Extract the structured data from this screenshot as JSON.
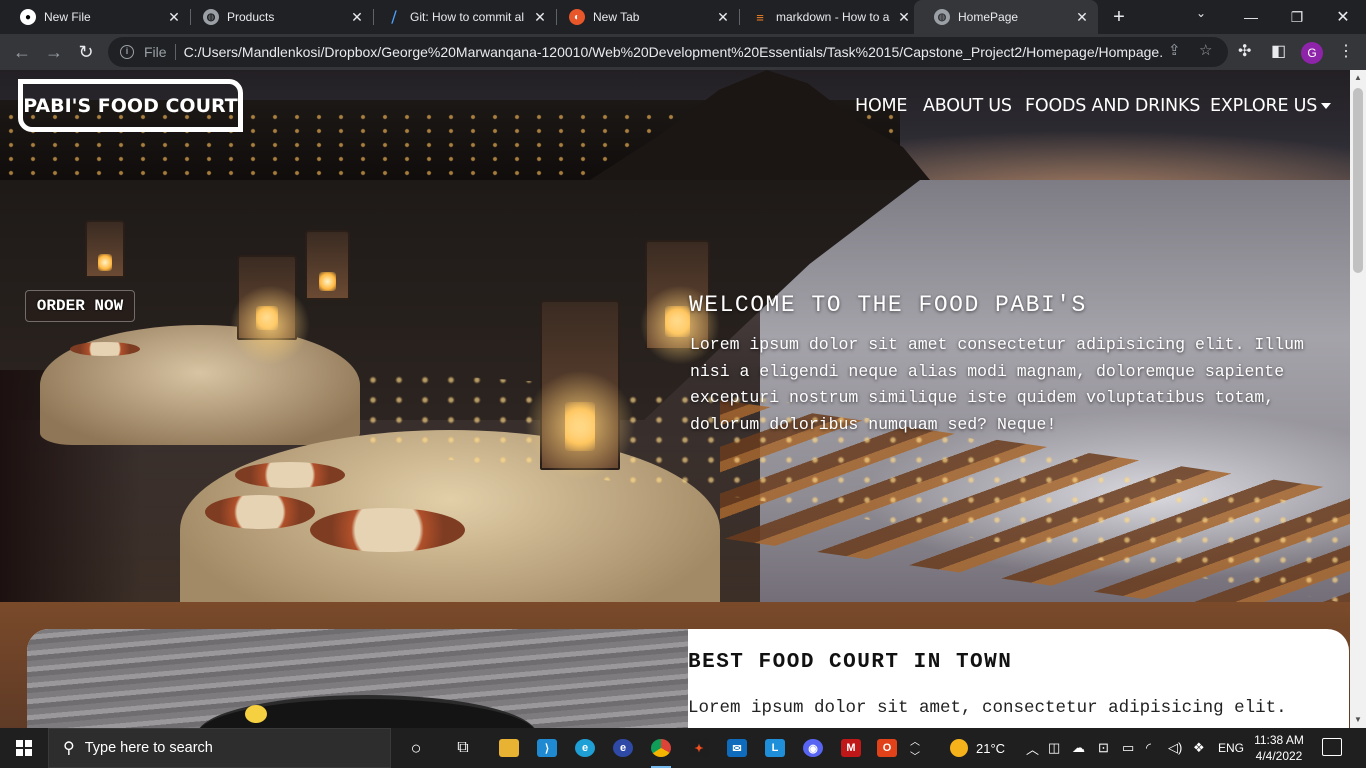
{
  "browser": {
    "tabs": [
      {
        "title": "New File",
        "icon": "github-icon"
      },
      {
        "title": "Products",
        "icon": "globe-icon"
      },
      {
        "title": "Git: How to commit al",
        "icon": "azure-devops-icon"
      },
      {
        "title": "New Tab",
        "icon": "new-tab-icon"
      },
      {
        "title": "markdown - How to a",
        "icon": "stackoverflow-icon"
      },
      {
        "title": "HomePage",
        "icon": "globe-icon",
        "active": true
      }
    ],
    "address": {
      "scheme": "File",
      "url": "C:/Users/Mandlenkosi/Dropbox/George%20Marwanqana-120010/Web%20Development%20Essentials/Task%2015/Capstone_Project2/Homepage/Hompage..."
    },
    "profile_initial": "G",
    "profile_color": "#8e24aa"
  },
  "page": {
    "brand": "PABI'S FOOD COURT",
    "nav": {
      "home": "HOME",
      "about": "ABOUT US",
      "foods": "FOODS AND DRINKS",
      "explore": "EXPLORE US"
    },
    "order_button": "ORDER NOW",
    "welcome": {
      "title": "WELCOME TO THE FOOD PABI'S",
      "text": "Lorem ipsum dolor sit amet consectetur adipisicing elit. Illum nisi a eligendi neque alias modi magnam, doloremque sapiente excepturi nostrum similique iste quidem voluptatibus totam, dolorum doloribus numquam sed? Neque!"
    },
    "section2": {
      "title": "BEST FOOD COURT IN TOWN",
      "text": "Lorem ipsum dolor sit amet, consectetur adipisicing elit."
    }
  },
  "taskbar": {
    "search_placeholder": "Type here to search",
    "weather": "21°C",
    "language": "ENG",
    "time": "11:38 AM",
    "date": "4/4/2022",
    "apps": [
      "cortana-icon",
      "task-view-icon",
      "file-explorer-icon",
      "vscode-icon",
      "edge-icon",
      "edge-dev-icon",
      "chrome-icon",
      "figma-icon",
      "mail-icon",
      "l-app-icon",
      "discord-icon",
      "mcafee-icon",
      "office-icon"
    ]
  }
}
